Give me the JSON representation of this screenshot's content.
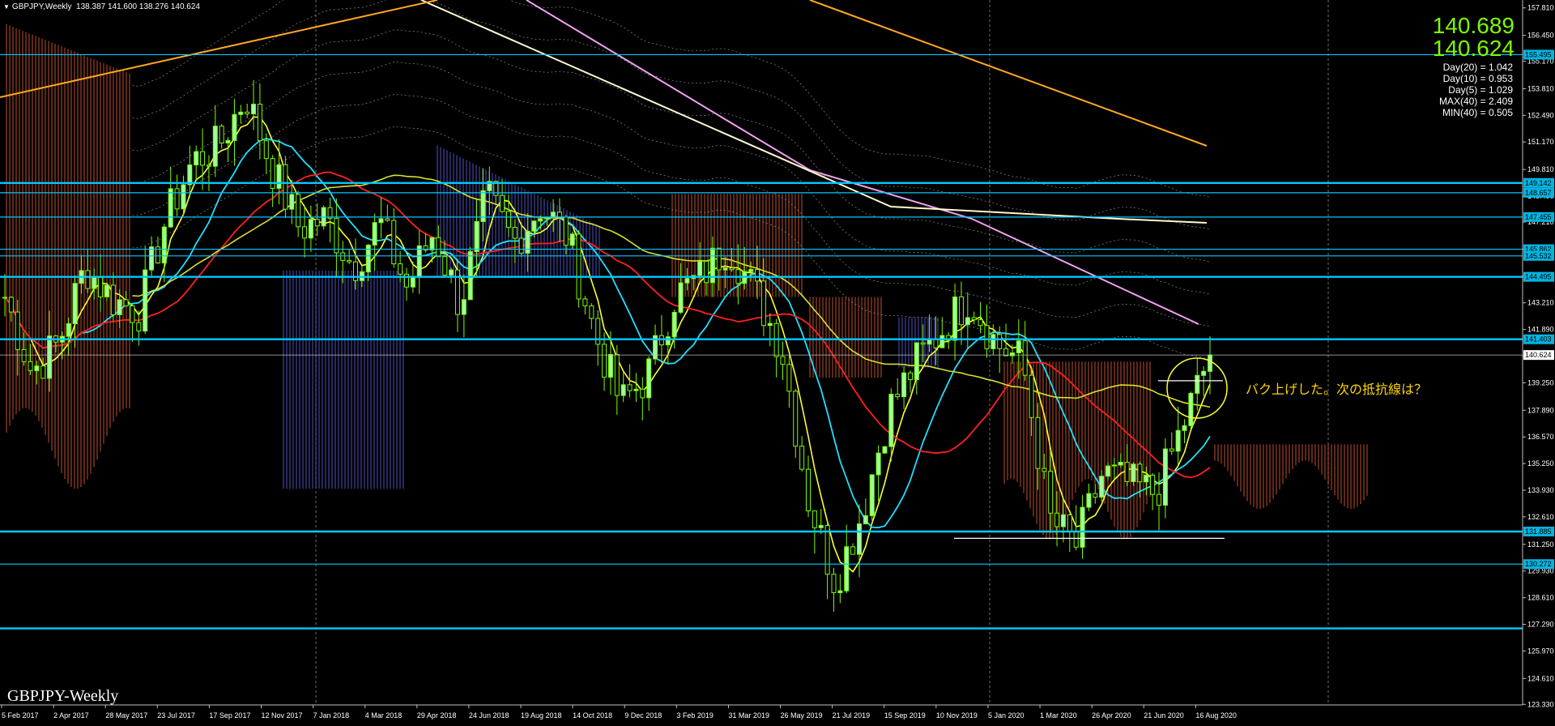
{
  "window": {
    "symbol_header": "GBPJPY,Weekly",
    "ohlc_header": "138.387 141.600 138.276 140.624",
    "watermark": "GBPJPY-Weekly"
  },
  "quotes": {
    "ask": "140.689",
    "bid": "140.624"
  },
  "stats": [
    "Day(20) = 1.042",
    "Day(10) = 0.953",
    "Day(5) = 1.029",
    "MAX(40) = 2.409",
    "MIN(40) = 0.505"
  ],
  "annotation": {
    "text": "バク上げした。次の抵抗線は？",
    "color": "#ffd400"
  },
  "colors": {
    "background": "#000000",
    "bull_candle": "#7cfc00",
    "bear_candle": "#9cff9c",
    "hline": "#00c8ff",
    "price_tag_bg": "#00b4e0",
    "current_price_line": "#c0c0c0",
    "ma_red": "#ff2020",
    "ma_cyan": "#20e0ff",
    "ma_yellow": "#ffff30",
    "ma_olive": "#d8e030",
    "ma_pink": "#f0a0f0",
    "ma_cream": "#fff8d0",
    "ma_orange": "#ffa820",
    "cloud_bull": "#ff6a3a",
    "cloud_bear": "#6a6aff"
  },
  "chart_data": {
    "type": "candlestick",
    "title": "GBPJPY,Weekly",
    "ylim": [
      123.3,
      158.2
    ],
    "grid": true,
    "x_tick_labels": [
      "5 Feb 2017",
      "2 Apr 2017",
      "28 May 2017",
      "23 Jul 2017",
      "17 Sep 2017",
      "12 Nov 2017",
      "7 Jan 2018",
      "4 Mar 2018",
      "29 Apr 2018",
      "24 Jun 2018",
      "19 Aug 2018",
      "14 Oct 2018",
      "9 Dec 2018",
      "3 Feb 2019",
      "31 Mar 2019",
      "26 May 2019",
      "21 Jul 2019",
      "15 Sep 2019",
      "10 Nov 2019",
      "5 Jan 2020",
      "1 Mar 2020",
      "26 Apr 2020",
      "21 Jun 2020",
      "16 Aug 2020"
    ],
    "y_tick_labels": [
      "157.810",
      "156.450",
      "155.170",
      "153.810",
      "152.490",
      "151.170",
      "149.810",
      "148.490",
      "147.210",
      "145.850",
      "144.530",
      "143.210",
      "141.890",
      "140.570",
      "139.250",
      "137.890",
      "136.570",
      "135.250",
      "133.930",
      "132.610",
      "131.250",
      "129.930",
      "128.610",
      "127.290",
      "125.970",
      "124.610",
      "123.330"
    ],
    "horizontal_levels": [
      {
        "price": 155.495,
        "label": "155.495",
        "style": "thin"
      },
      {
        "price": 149.142,
        "label": "149.142",
        "style": "thick"
      },
      {
        "price": 148.657,
        "label": "148.657",
        "style": "thin"
      },
      {
        "price": 147.455,
        "label": "147.455",
        "style": "thin"
      },
      {
        "price": 145.862,
        "label": "145.862",
        "style": "thin"
      },
      {
        "price": 145.532,
        "label": "145.532",
        "style": "thin"
      },
      {
        "price": 144.495,
        "label": "144.495",
        "style": "thick"
      },
      {
        "price": 141.403,
        "label": "141.403",
        "style": "thick"
      },
      {
        "price": 131.885,
        "label": "131.885",
        "style": "thick"
      },
      {
        "price": 130.272,
        "label": "130.272",
        "style": "thin"
      },
      {
        "price": 127.09,
        "label": "",
        "style": "thick"
      }
    ],
    "current_price": {
      "price": 140.624,
      "label": "140.624"
    },
    "closes_monthly": [
      143.5,
      139.8,
      141.2,
      145.0,
      143.4,
      142.8,
      147.3,
      150.2,
      151.0,
      153.5,
      149.8,
      146.9,
      147.4,
      145.0,
      147.2,
      144.0,
      146.7,
      143.1,
      148.5,
      146.2,
      148.0,
      146.5,
      141.8,
      138.2,
      139.6,
      143.5,
      144.5,
      146.1,
      143.8,
      141.0,
      133.5,
      129.4,
      132.8,
      137.9,
      140.2,
      141.9,
      143.5,
      141.2,
      140.3,
      132.5,
      131.2,
      134.8,
      134.2,
      133.8,
      137.2,
      140.624
    ]
  }
}
